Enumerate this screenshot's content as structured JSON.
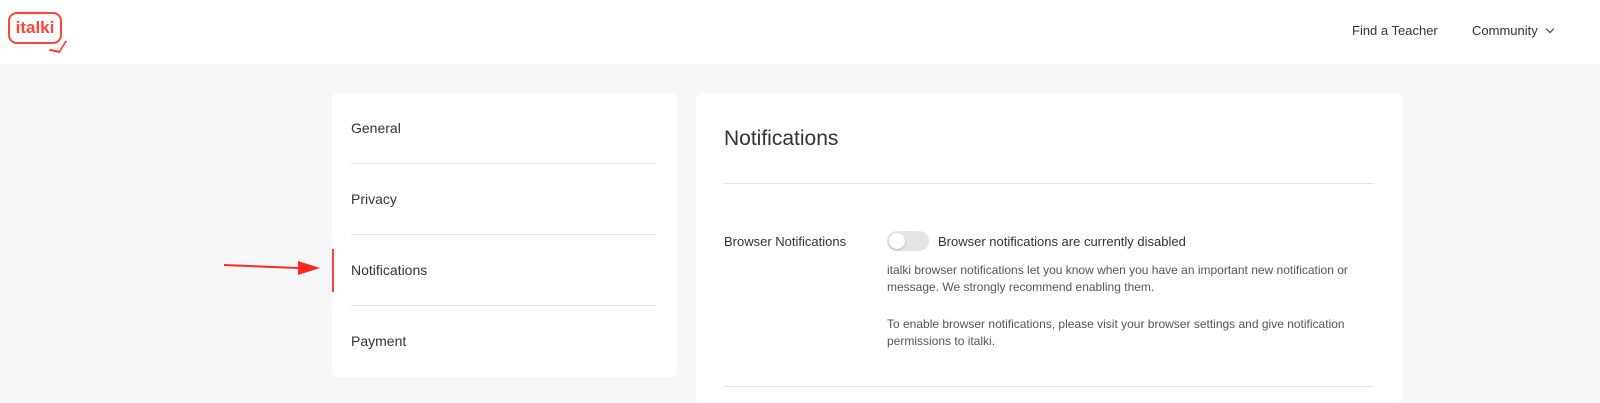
{
  "header": {
    "logo_text": "italki",
    "nav": {
      "find_teacher": "Find a Teacher",
      "community": "Community"
    }
  },
  "sidebar": {
    "items": [
      {
        "label": "General"
      },
      {
        "label": "Privacy"
      },
      {
        "label": "Notifications",
        "active": true
      },
      {
        "label": "Payment"
      }
    ]
  },
  "main": {
    "title": "Notifications",
    "browser_notifications": {
      "label": "Browser Notifications",
      "toggle_on": false,
      "status": "Browser notifications are currently disabled",
      "description": "italki browser notifications let you know when you have an important new notification or message. We strongly recommend enabling them.",
      "instructions": "To enable browser notifications, please visit your browser settings and give notification permissions to italki."
    }
  },
  "colors": {
    "brand": "#ff4438",
    "background": "#f7f7f9",
    "annotation_arrow": "#ff2a1f"
  }
}
